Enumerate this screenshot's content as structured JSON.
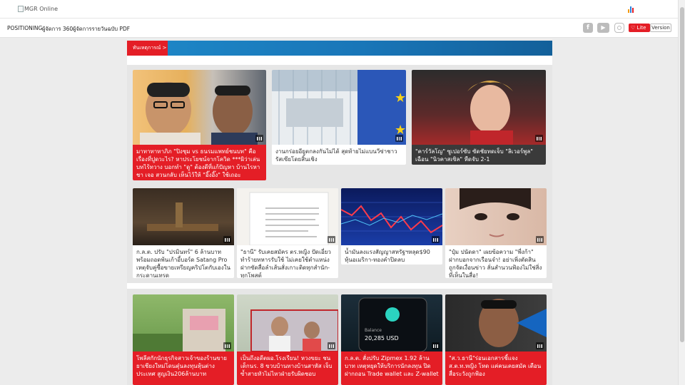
{
  "header": {
    "logo_alt": "MGR Online"
  },
  "nav": {
    "links": [
      "POSITIONING",
      "ผู้จัดการ 360",
      "ผู้จัดการรายวันฉบับ PDF"
    ],
    "lite_label": "Lite",
    "version_label": "Version"
  },
  "breaking": {
    "label": "ทันเหตุการณ์ >"
  },
  "news_top": [
    {
      "caption": "มาทาทาทาภิภ \"ปิงชุม vs ธนรมแพทย์ชนบท\" คือเรื่องที่ปูดวะไร? หาประโยชน์จากโควิด ***ผิว่าเล่นบทไร้ทวาง บอกทำ \"ดู\" ต้องดีที่แก้ปัญหา บ้านไรหาชา เจอ สวนกลับ เห็นไว้ให้ \"อิ๊งอิ๊ง\" ใช้เถอะ"
    },
    {
      "caption": "งานกร่อยอียูตกลงกันไม่ได้ สุดท้ายไม่แบนวีซ่าชาวรัสเซียโดยสิ้นเชิง"
    },
    {
      "caption": "\"คาร์วัลโญ\" ซูเปอร์ซับ ซัดชัยทดเจ็บ \"ลิเวอร์พูล\" เฉือน \"นิวคาสเซิล\" หืดจับ 2-1"
    }
  ],
  "news_mid": [
    {
      "caption": "ก.ล.ต. ปรับ \"ปรมินทร์\" 6 ล้านบาท พร้อมถอดพ้นเก้าอี้บอร์ด Satang Pro เหตุจับคู่ซื้อขายเหรียญคริปโตกับเองในกระดานเทรด"
    },
    {
      "caption": "\"ธานี\" รับเคยสมัคร ตร.หญิง ปัดเอี่ยวทำร้ายทหารรับใช้ ไม่เคยใช้ตำแหน่งฝากซัดสื่อลำเส้นสั่งเกาะติดทุกสำนัก-ทุกโพสต์"
    },
    {
      "caption": "น้ำมันลงแรงสัญญาสหรัฐฯหลุด$90 หุ้นอเมริกา-ทองคำปิดลบ"
    },
    {
      "caption": "\"ปุ๋ม ปนัดดา\" เผยข้อความ \"พี่งก้า\" ฝากบอกจากเรือนจำ! อย่าเพิ่งตัดสิน ถูกจัดเงื่อนข่าว ลั่นสำนวนฟ้องไม่ใช่สิ่งที่เห็นในสื่อ!"
    }
  ],
  "news_bottom": [
    {
      "caption": "โพลีสกักนักธุรกิจสาวเจ้าของร้านขายยาเชียงใหม่โดนตุ๋นลงทุนหุ้นต่างประเทศ สูญเงิน206ล้านบาท"
    },
    {
      "caption": "เป็นถึงอดีตผอ.โรงเรียน! หวงขยะ ชนเด็กนร. 8 ขวบบ้านทางบ้านสาหัส เจ็บซ้ำสายหัวไม่ไหวฝ่ายรับผิดชอบ"
    },
    {
      "caption": "ก.ล.ต. สั่งปรับ Zipmex 1.92 ล้านบาท เหตุหยุดให้บริการนักลงทุน ปิดฝากถอน Trade wallet และ Z-wallet"
    },
    {
      "caption": "\"ส.ว.ธานี\"ร่อนเอกสารชี้แจง ส.ต.ท.หญิง โหด แค่คนเคยสมัค เตือนสื่อระวังถูกฟ้อง"
    }
  ],
  "colors": {
    "accent_red": "#e41e26",
    "breaking_blue": "#1976b8"
  }
}
